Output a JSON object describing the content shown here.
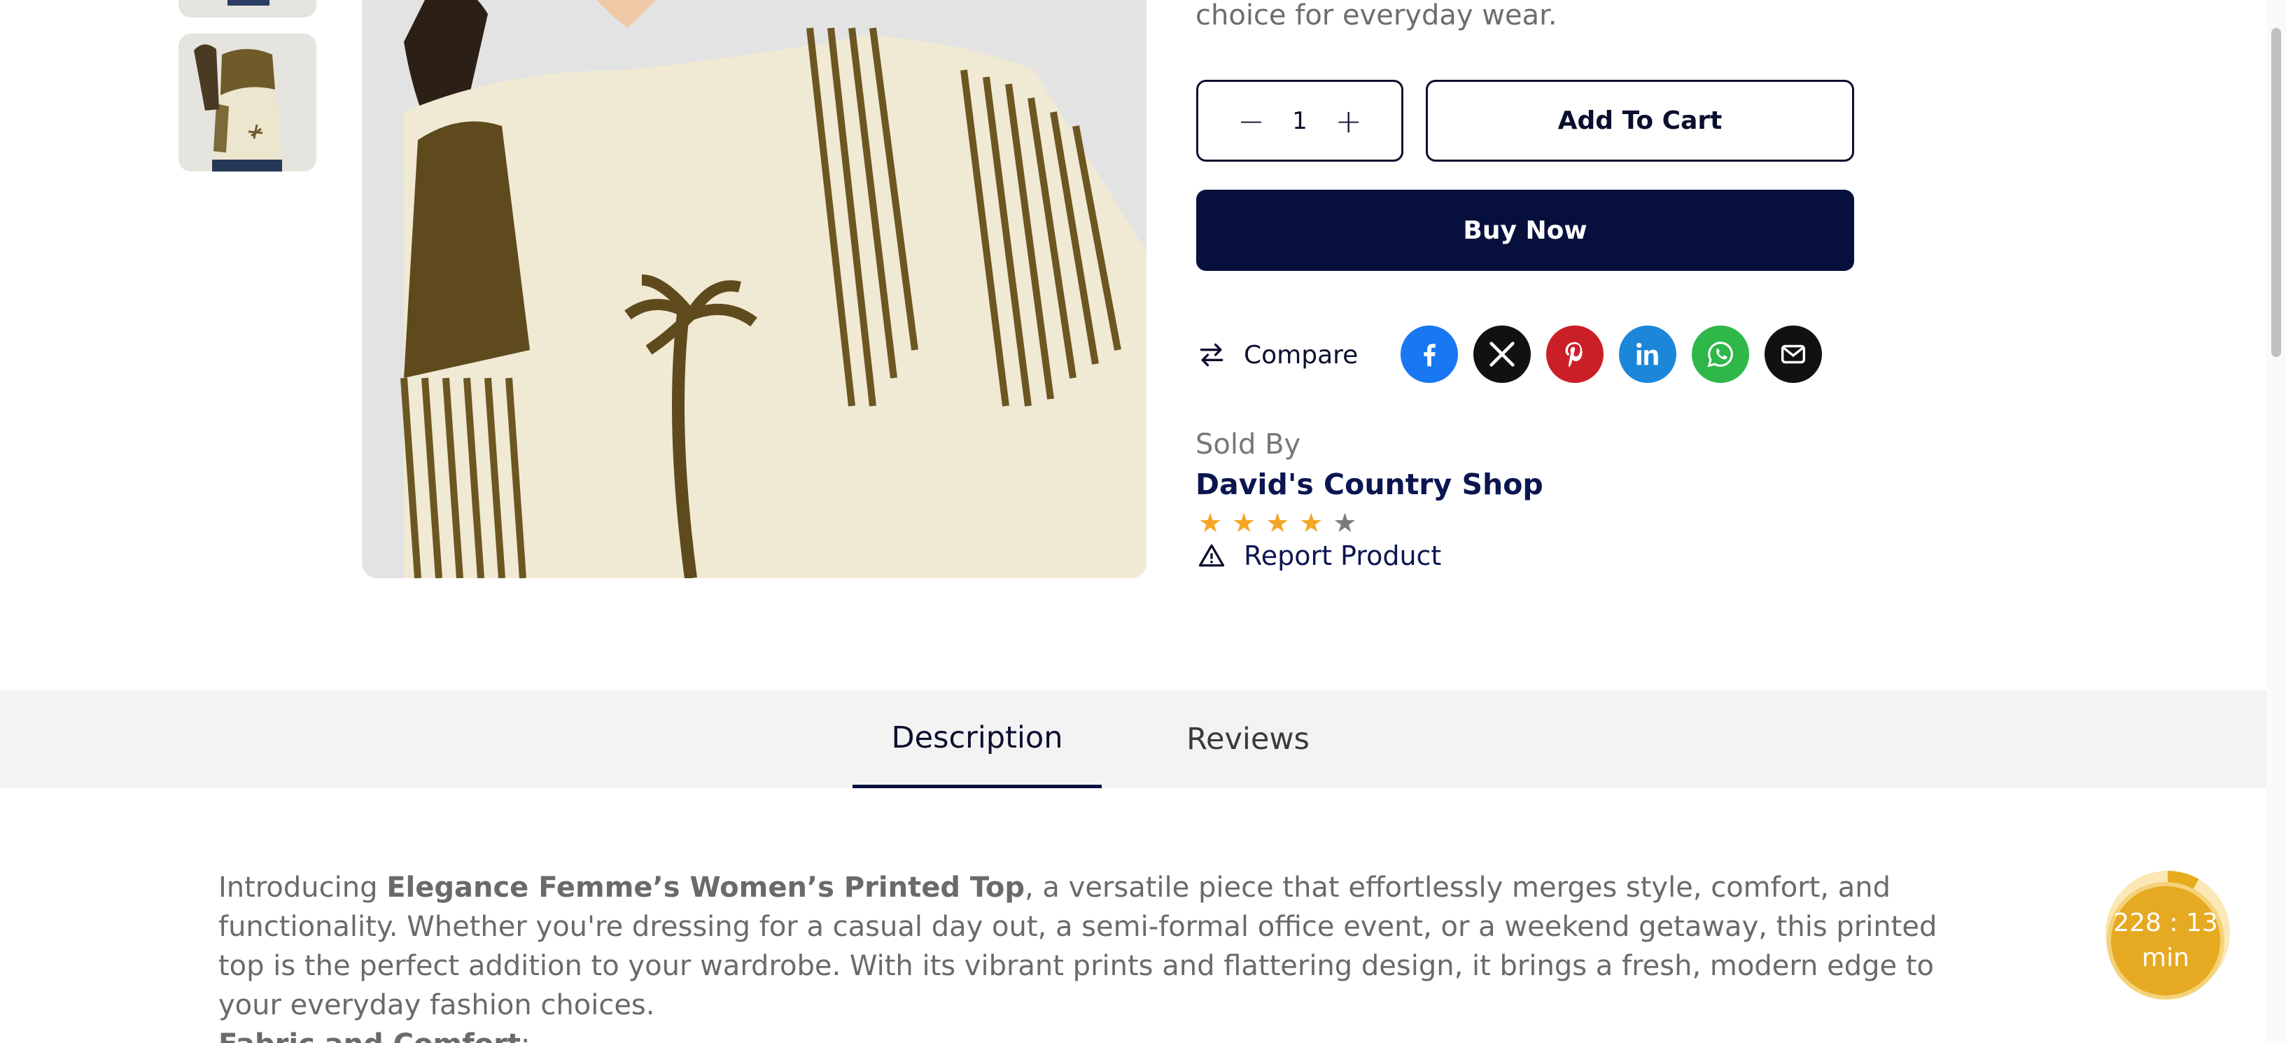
{
  "product": {
    "tagline": "choice for everyday wear."
  },
  "actions": {
    "quantity": "1",
    "add_to_cart": "Add To Cart",
    "buy_now": "Buy Now",
    "compare": "Compare"
  },
  "share": {
    "icons": [
      "facebook-icon",
      "x-twitter-icon",
      "pinterest-icon",
      "linkedin-icon",
      "whatsapp-icon",
      "email-icon"
    ],
    "colors": {
      "facebook": "#1877f2",
      "x": "#111111",
      "pinterest": "#cb1f27",
      "linkedin": "#1c87d9",
      "whatsapp": "#2fb74a",
      "email": "#111111"
    }
  },
  "seller": {
    "sold_by_label": "Sold By",
    "name": "David's Country Shop",
    "rating": 4,
    "rating_max": 5,
    "report_label": "Report Product"
  },
  "tabs": [
    {
      "label": "Description",
      "active": true
    },
    {
      "label": "Reviews",
      "active": false
    }
  ],
  "description": {
    "intro_prefix": "Introducing ",
    "product_name": "Elegance Femme’s Women’s Printed Top",
    "intro_rest": ", a versatile piece that effortlessly merges style, comfort, and functionality. Whether you're dressing for a casual day out, a semi-formal office event, or a weekend getaway, this printed top is the perfect addition to your wardrobe. With its vibrant prints and flattering design, it brings a fresh, modern edge to your everyday fashion choices.",
    "section_heading": "Fabric and Comfort",
    "section_colon": ":"
  },
  "timer": {
    "value": "228 : 13",
    "unit": "min"
  },
  "colors": {
    "primary": "#07103d",
    "star_filled": "#f5a623",
    "star_empty": "#7a7a7a",
    "timer": "#e6a922"
  }
}
